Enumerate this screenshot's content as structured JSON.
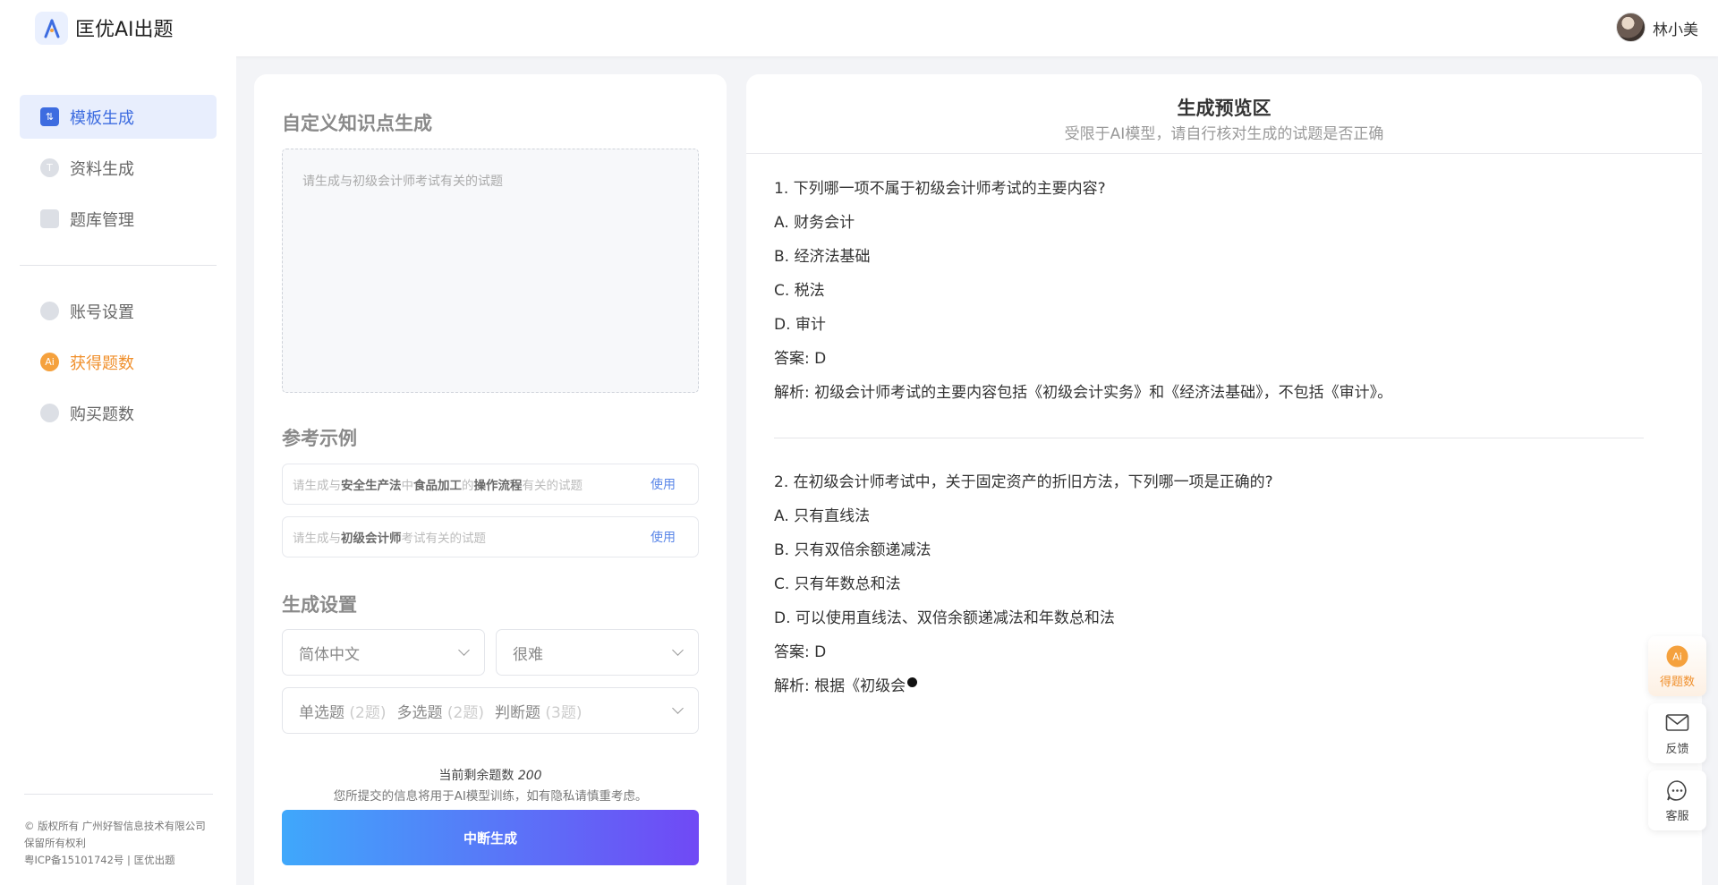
{
  "header": {
    "app_title": "匡优AI出题",
    "username": "林小美"
  },
  "sidebar": {
    "items": [
      {
        "label": "模板生成",
        "icon": "template-icon",
        "active": true
      },
      {
        "label": "资料生成",
        "icon": "document-icon"
      },
      {
        "label": "题库管理",
        "icon": "library-icon"
      },
      {
        "label": "账号设置",
        "icon": "user-icon"
      },
      {
        "label": "获得题数",
        "icon": "ai-coin-icon"
      },
      {
        "label": "购买题数",
        "icon": "diamond-icon"
      }
    ],
    "footer": {
      "line1": "© 版权所有 广州好智信息技术有限公司",
      "line2": "保留所有权利",
      "line3": "粤ICP备15101742号 | 匡优出题"
    }
  },
  "left_panel": {
    "custom_title": "自定义知识点生成",
    "textarea_placeholder": "请生成与初级会计师考试有关的试题",
    "examples_title": "参考示例",
    "examples": [
      {
        "p1": "请生成与",
        "b1": "安全生产法",
        "p2": "中",
        "b2": "食品加工",
        "p3": "的",
        "b3": "操作流程",
        "p4": "有关的试题",
        "use": "使用"
      },
      {
        "p1": "请生成与",
        "b1": "初级会计师",
        "p2": "考试有关的试题",
        "use": "使用"
      }
    ],
    "settings_title": "生成设置",
    "language": "简体中文",
    "difficulty": "很难",
    "question_types": [
      {
        "label": "单选题",
        "count": "(2题)"
      },
      {
        "label": "多选题",
        "count": "(2题)"
      },
      {
        "label": "判断题",
        "count": "(3题)"
      }
    ],
    "remaining_label": "当前剩余题数",
    "remaining_value": "200",
    "privacy_note": "您所提交的信息将用于AI模型训练，如有隐私请慎重考虑。",
    "stop_button": "中断生成"
  },
  "preview": {
    "title": "生成预览区",
    "subtitle": "受限于AI模型，请自行核对生成的试题是否正确",
    "q1": {
      "question": "1. 下列哪一项不属于初级会计师考试的主要内容?",
      "a": "A. 财务会计",
      "b": "B. 经济法基础",
      "c": "C. 税法",
      "d": "D. 审计",
      "answer": "答案: D",
      "analysis": "解析: 初级会计师考试的主要内容包括《初级会计实务》和《经济法基础》，不包括《审计》。"
    },
    "q2": {
      "question": "2. 在初级会计师考试中，关于固定资产的折旧方法，下列哪一项是正确的?",
      "a": "A. 只有直线法",
      "b": "B. 只有双倍余额递减法",
      "c": "C. 只有年数总和法",
      "d": "D. 可以使用直线法、双倍余额递减法和年数总和法",
      "answer": "答案: D",
      "analysis": "解析: 根据《初级会"
    }
  },
  "floating": {
    "get_count": "得题数",
    "feedback": "反馈",
    "service": "客服"
  }
}
